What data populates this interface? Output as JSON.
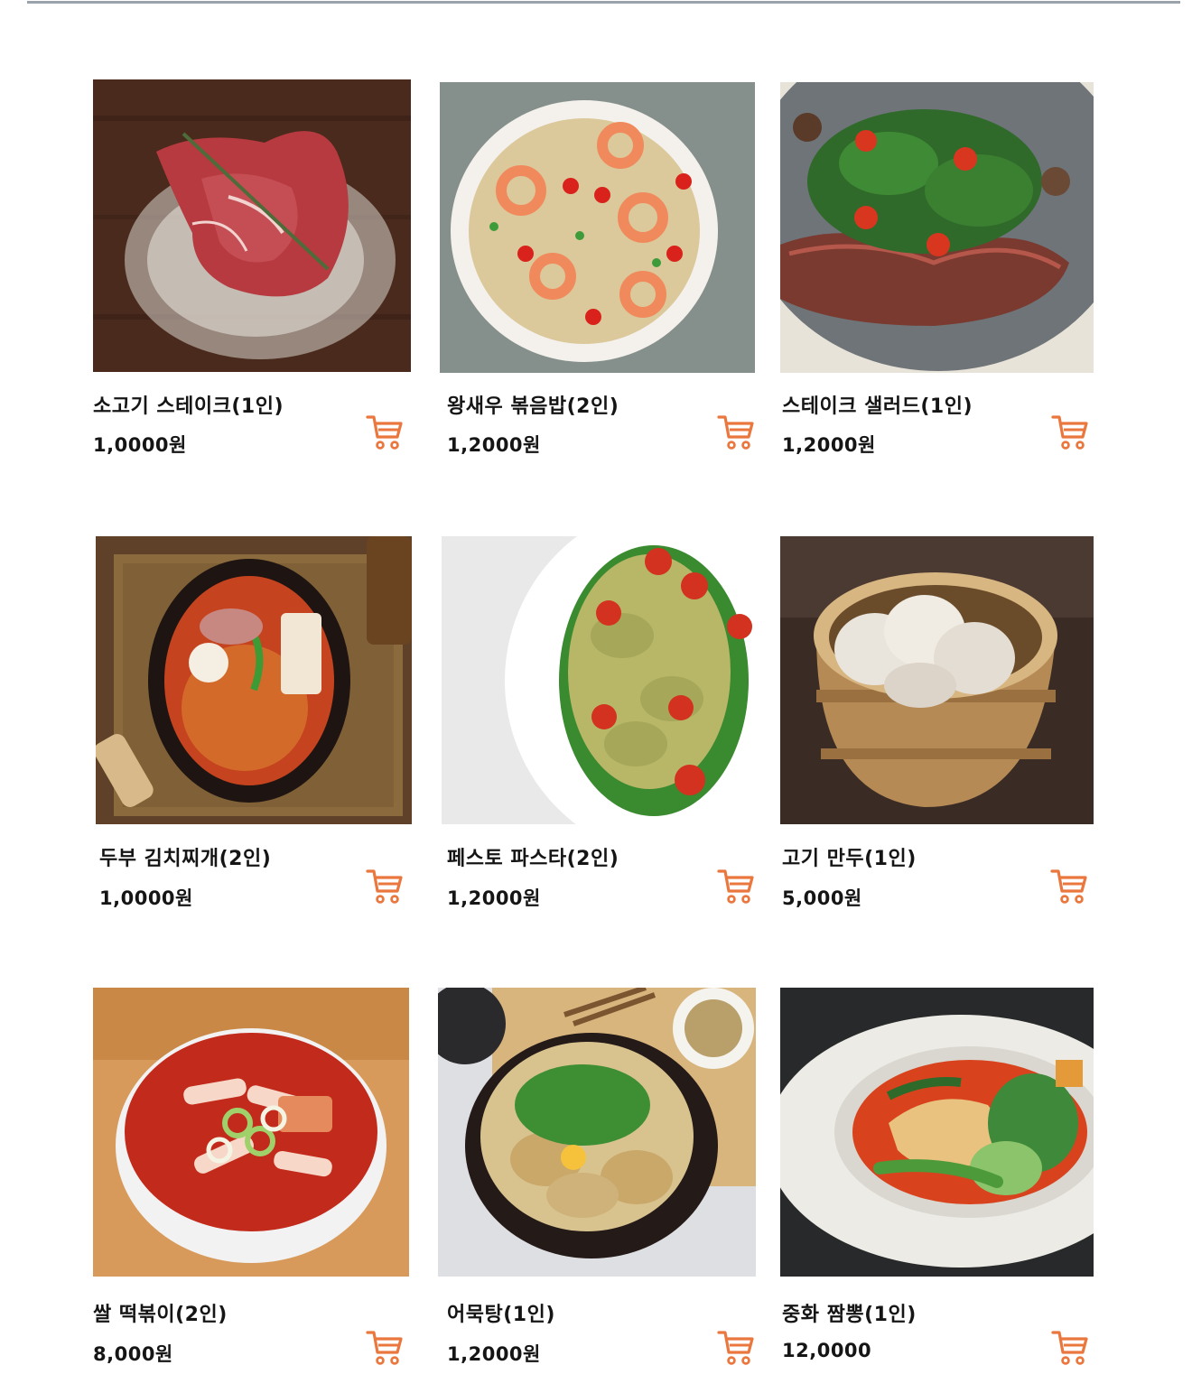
{
  "accent_color": "#e9773e",
  "cart_icon": "shopping-cart-icon",
  "products": [
    {
      "name": "소고기 스테이크(1인)",
      "price": "1,0000원",
      "image": "raw-steak-photo"
    },
    {
      "name": "왕새우 볶음밥(2인)",
      "price": "1,2000원",
      "image": "shrimp-fried-rice-photo"
    },
    {
      "name": "스테이크 샐러드(1인)",
      "price": "1,2000원",
      "image": "steak-salad-photo"
    },
    {
      "name": "두부 김치찌개(2인)",
      "price": "1,0000원",
      "image": "kimchi-stew-photo"
    },
    {
      "name": "페스토 파스타(2인)",
      "price": "1,2000원",
      "image": "pesto-pasta-photo"
    },
    {
      "name": "고기 만두(1인)",
      "price": "5,000원",
      "image": "dumplings-photo"
    },
    {
      "name": "쌀 떡볶이(2인)",
      "price": "8,000원",
      "image": "tteokbokki-photo"
    },
    {
      "name": "어묵탕(1인)",
      "price": "1,2000원",
      "image": "fishcake-soup-photo"
    },
    {
      "name": "중화 짬뽕(1인)",
      "price": "12,0000",
      "image": "jjamppong-photo"
    }
  ]
}
